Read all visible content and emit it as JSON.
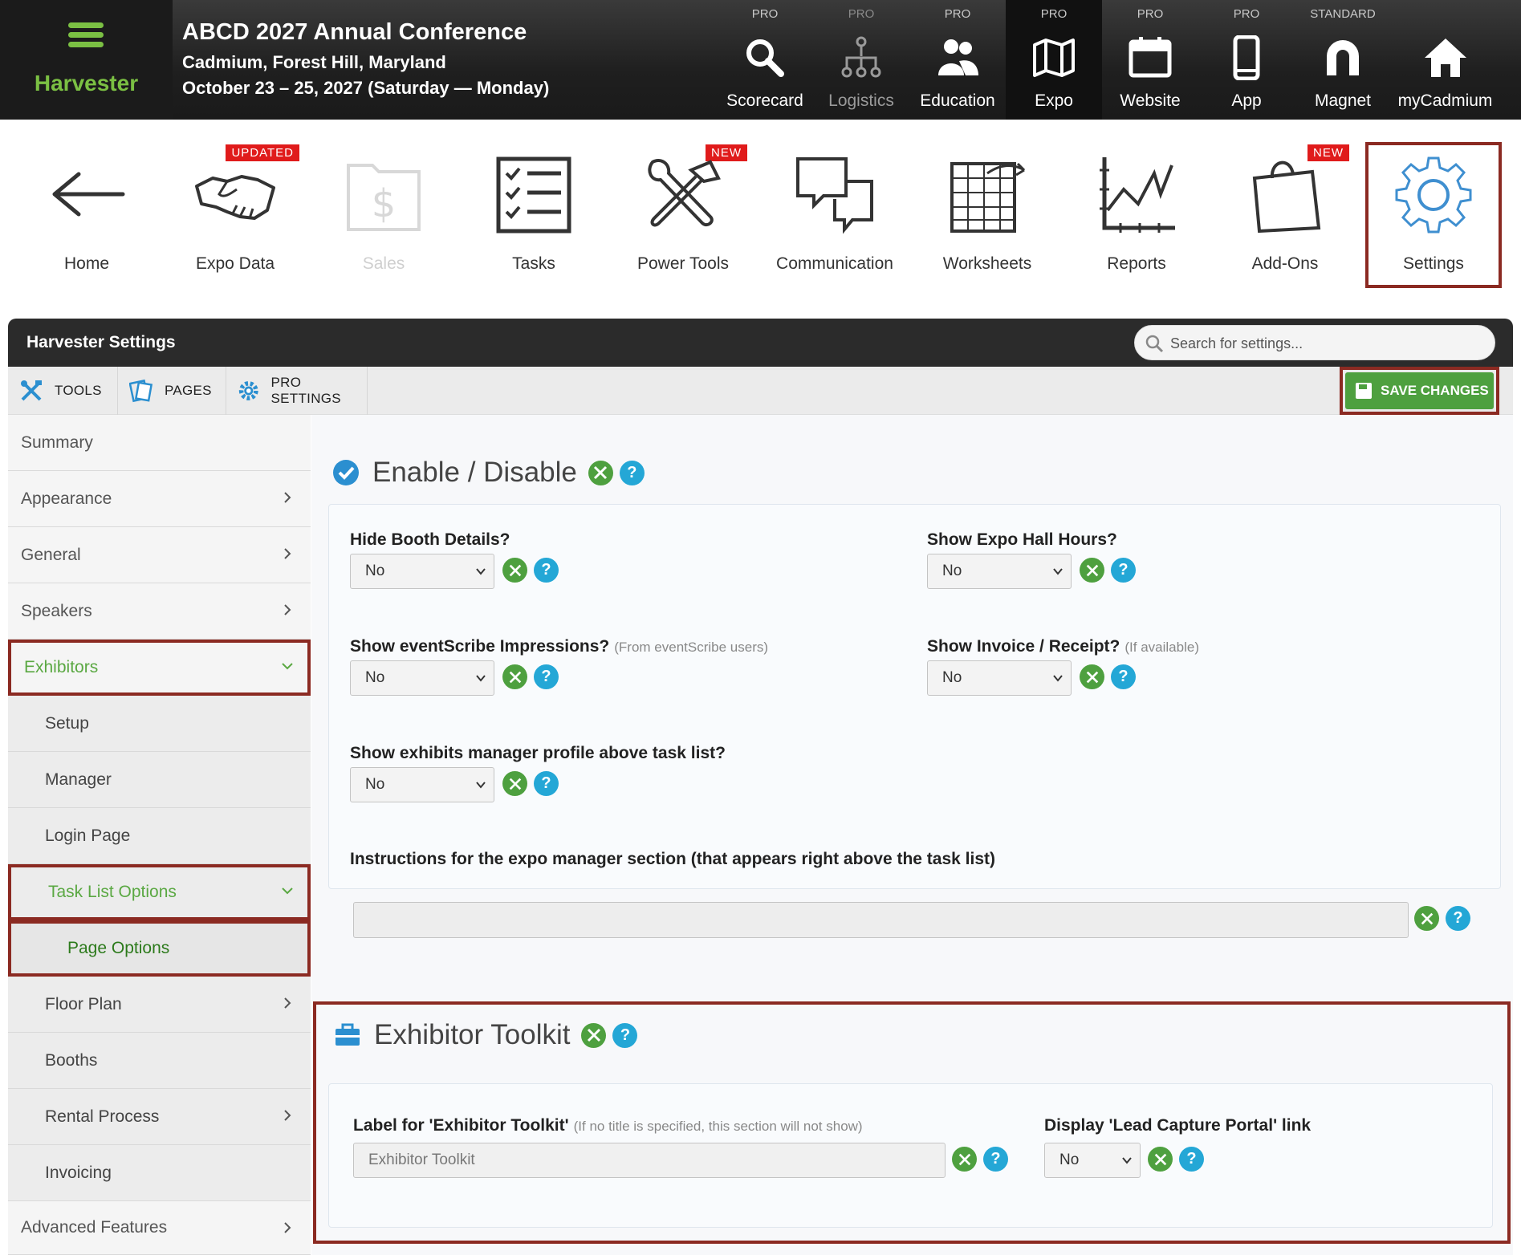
{
  "brand": {
    "name": "Harvester"
  },
  "event": {
    "title": "ABCD 2027 Annual Conference",
    "location": "Cadmium, Forest Hill, Maryland",
    "dates": "October 23 – 25, 2027 (Saturday — Monday)"
  },
  "topnav": [
    {
      "tier": "PRO",
      "label": "Scorecard",
      "icon": "magnifier-icon"
    },
    {
      "tier": "PRO",
      "label": "Logistics",
      "icon": "org-chart-icon"
    },
    {
      "tier": "PRO",
      "label": "Education",
      "icon": "people-icon"
    },
    {
      "tier": "PRO",
      "label": "Expo",
      "icon": "map-icon"
    },
    {
      "tier": "PRO",
      "label": "Website",
      "icon": "calendar-icon"
    },
    {
      "tier": "PRO",
      "label": "App",
      "icon": "phone-icon"
    },
    {
      "tier": "STANDARD",
      "label": "Magnet",
      "icon": "magnet-icon"
    },
    {
      "tier": "",
      "label": "myCadmium",
      "icon": "home-icon"
    }
  ],
  "tools": [
    {
      "label": "Home",
      "badge": ""
    },
    {
      "label": "Expo Data",
      "badge": "UPDATED"
    },
    {
      "label": "Sales",
      "badge": ""
    },
    {
      "label": "Tasks",
      "badge": ""
    },
    {
      "label": "Power Tools",
      "badge": "NEW"
    },
    {
      "label": "Communication",
      "badge": ""
    },
    {
      "label": "Worksheets",
      "badge": ""
    },
    {
      "label": "Reports",
      "badge": ""
    },
    {
      "label": "Add-Ons",
      "badge": "NEW"
    },
    {
      "label": "Settings",
      "badge": ""
    }
  ],
  "panel": {
    "title": "Harvester Settings",
    "search_placeholder": "Search for settings...",
    "tabs": [
      "TOOLS",
      "PAGES",
      "PRO SETTINGS"
    ],
    "save_label": "SAVE CHANGES"
  },
  "sidebar": [
    "Summary",
    "Appearance",
    "General",
    "Speakers",
    "Exhibitors",
    "Setup",
    "Manager",
    "Login Page",
    "Task List Options",
    "Page Options",
    "Floor Plan",
    "Booths",
    "Rental Process",
    "Invoicing",
    "Advanced Features"
  ],
  "enable_section": {
    "title": "Enable / Disable",
    "fields": {
      "hide_booth": {
        "label": "Hide Booth Details?",
        "value": "No"
      },
      "expo_hours": {
        "label": "Show Expo Hall Hours?",
        "value": "No"
      },
      "impressions": {
        "label": "Show eventScribe Impressions?",
        "note": "(From eventScribe users)",
        "value": "No"
      },
      "invoice": {
        "label": "Show Invoice / Receipt?",
        "note": "(If available)",
        "value": "No"
      },
      "manager_profile": {
        "label": "Show exhibits manager profile above task list?",
        "value": "No"
      },
      "instructions": {
        "label": "Instructions for the expo manager section (that appears right above the task list)",
        "value": ""
      }
    }
  },
  "toolkit_section": {
    "title": "Exhibitor Toolkit",
    "label_field": {
      "label": "Label for 'Exhibitor Toolkit'",
      "note": "(If no title is specified, this section will not show)",
      "value": "Exhibitor Toolkit"
    },
    "lead_capture": {
      "label": "Display 'Lead Capture Portal' link",
      "value": "No"
    }
  },
  "help_glyph": "?",
  "colors": {
    "accent_green": "#4ea03f",
    "help_blue": "#24a7d6",
    "highlight_border": "#8b2a22",
    "brand_green": "#7bc043"
  }
}
